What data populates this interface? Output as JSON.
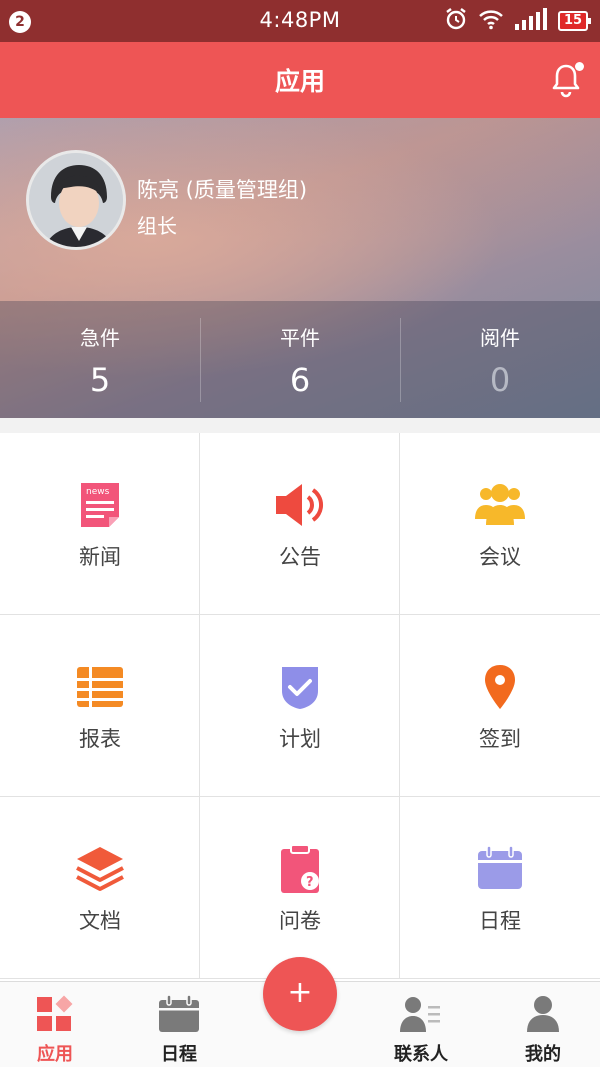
{
  "status_bar": {
    "notification_count": "2",
    "time": "4:48PM",
    "battery": "15",
    "icons": [
      "alarm-icon",
      "wifi-icon",
      "signal-icon",
      "battery-icon"
    ]
  },
  "header": {
    "title": "应用",
    "bell_icon": "bell-icon"
  },
  "profile": {
    "name": "陈亮 (质量管理组)",
    "role": "组长",
    "stats": [
      {
        "label": "急件",
        "value": "5"
      },
      {
        "label": "平件",
        "value": "6"
      },
      {
        "label": "阅件",
        "value": "0"
      }
    ]
  },
  "apps": [
    {
      "label": "新闻",
      "icon": "news-icon",
      "color": "#f2557a"
    },
    {
      "label": "公告",
      "icon": "megaphone-icon",
      "color": "#ee4a3f"
    },
    {
      "label": "会议",
      "icon": "people-icon",
      "color": "#f7b82a"
    },
    {
      "label": "报表",
      "icon": "report-list-icon",
      "color": "#f48a24"
    },
    {
      "label": "计划",
      "icon": "plan-check-icon",
      "color": "#8e8ee8"
    },
    {
      "label": "签到",
      "icon": "location-pin-icon",
      "color": "#f26a1e"
    },
    {
      "label": "文档",
      "icon": "layers-icon",
      "color": "#f05a3a"
    },
    {
      "label": "问卷",
      "icon": "clipboard-question-icon",
      "color": "#f2557a"
    },
    {
      "label": "日程",
      "icon": "calendar-icon",
      "color": "#9b9be8"
    }
  ],
  "bottom_nav": {
    "items": [
      {
        "label": "应用",
        "icon": "apps-grid-icon",
        "active": true
      },
      {
        "label": "日程",
        "icon": "calendar-icon"
      },
      {
        "label": "联系人",
        "icon": "contacts-icon"
      },
      {
        "label": "我的",
        "icon": "person-icon"
      }
    ],
    "fab_label": "+",
    "accent": "#ee5555"
  }
}
